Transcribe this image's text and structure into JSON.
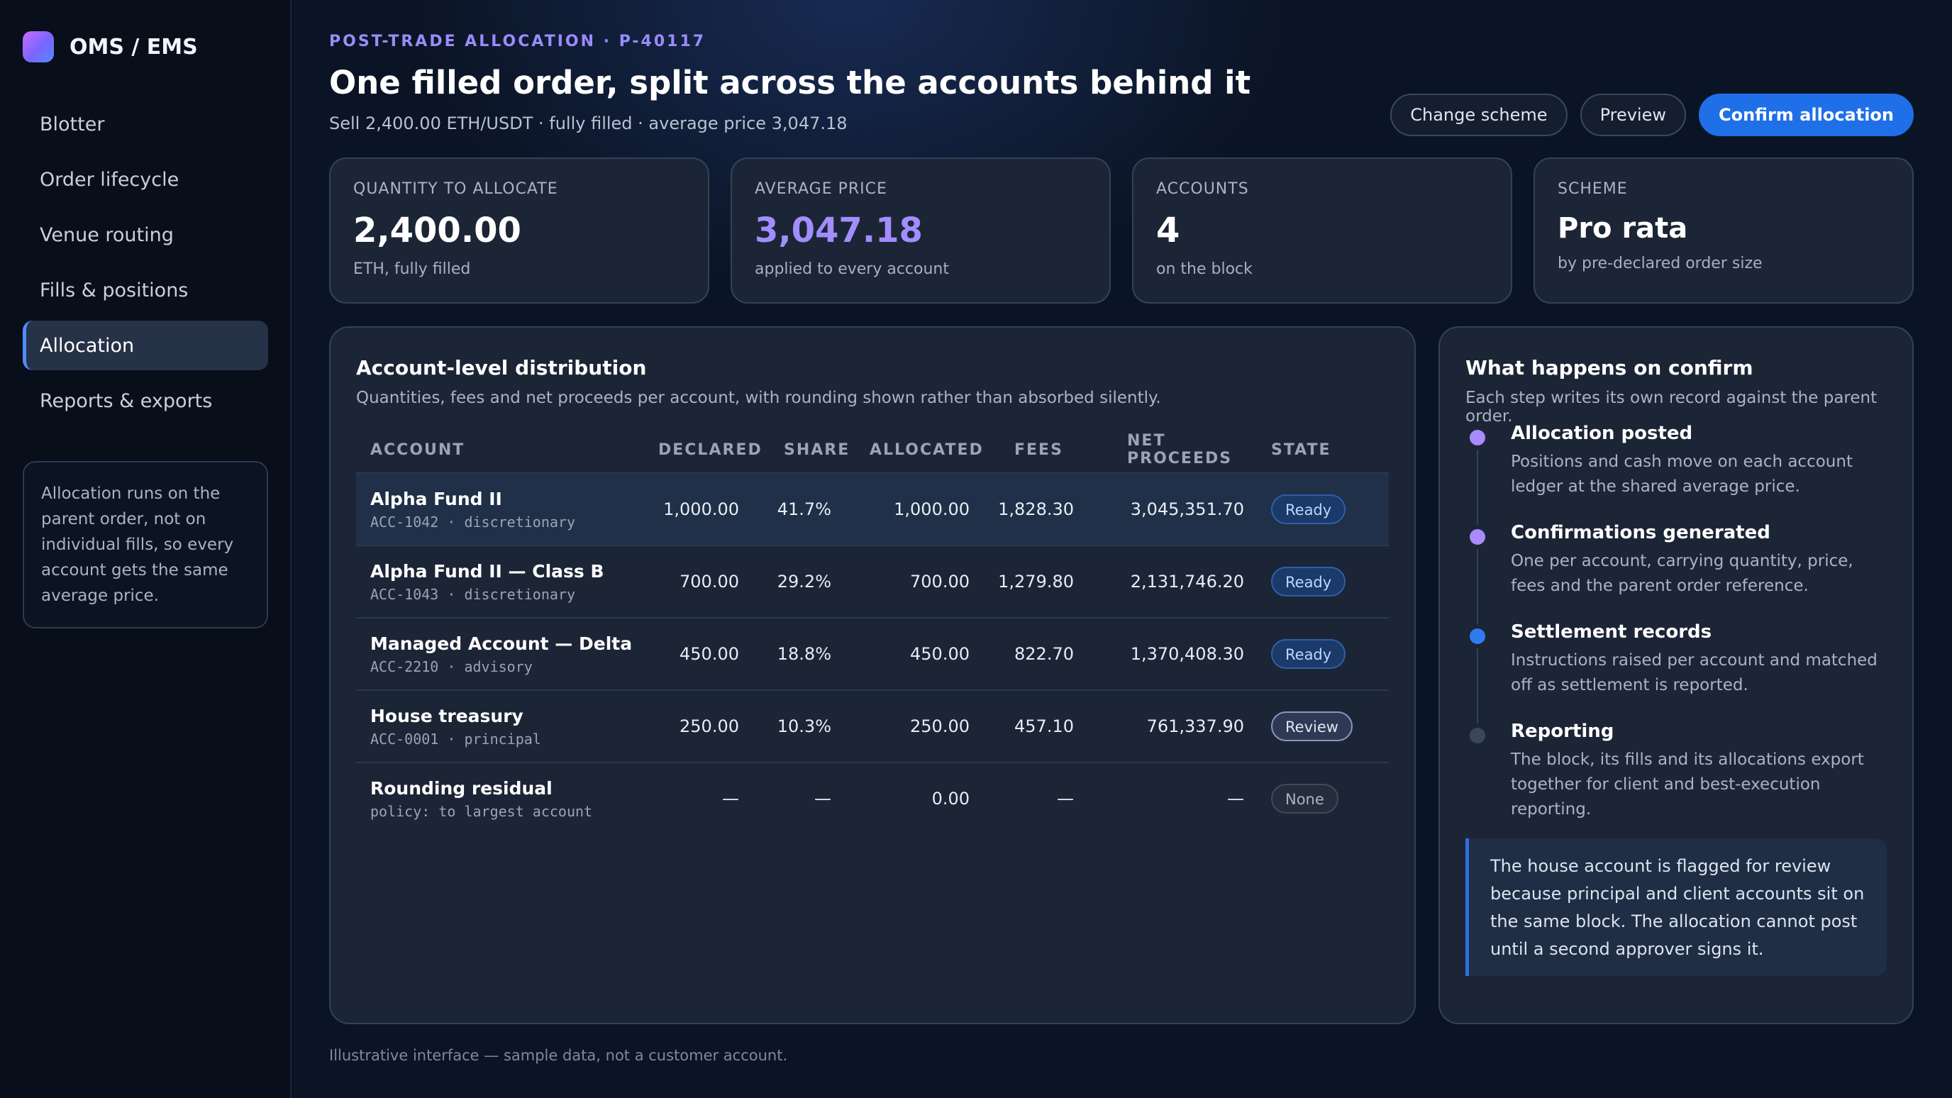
{
  "app": {
    "brand": "OMS / EMS"
  },
  "sidebar": {
    "items": [
      {
        "label": "Blotter"
      },
      {
        "label": "Order lifecycle"
      },
      {
        "label": "Venue routing"
      },
      {
        "label": "Fills & positions"
      },
      {
        "label": "Allocation",
        "active": true
      },
      {
        "label": "Reports & exports"
      }
    ],
    "note": "Allocation runs on the parent order, not on individual fills, so every account gets the same average price."
  },
  "header": {
    "eyebrow": "POST-TRADE ALLOCATION · P-40117",
    "title": "One filled order, split across the accounts behind it",
    "subtitle": "Sell 2,400.00 ETH/USDT · fully filled · average price 3,047.18",
    "buttons": {
      "change_scheme": "Change scheme",
      "preview": "Preview",
      "confirm": "Confirm allocation"
    }
  },
  "stats": [
    {
      "label": "QUANTITY TO ALLOCATE",
      "value": "2,400.00",
      "note": "ETH, fully filled"
    },
    {
      "label": "AVERAGE PRICE",
      "value": "3,047.18",
      "note": "applied to every account"
    },
    {
      "label": "ACCOUNTS",
      "value": "4",
      "note": "on the block"
    },
    {
      "label": "SCHEME",
      "value": "Pro rata",
      "note": "by pre-declared order size"
    }
  ],
  "distribution": {
    "title": "Account-level distribution",
    "subtitle": "Quantities, fees and net proceeds per account, with rounding shown rather than absorbed silently.",
    "columns": [
      "ACCOUNT",
      "DECLARED",
      "SHARE",
      "ALLOCATED",
      "FEES",
      "NET PROCEEDS",
      "STATE"
    ],
    "rows": [
      {
        "name": "Alpha Fund II",
        "meta": "ACC-1042 · discretionary",
        "declared": "1,000.00",
        "share": "41.7%",
        "allocated": "1,000.00",
        "fees": "1,828.30",
        "net": "3,045,351.70",
        "state": "Ready"
      },
      {
        "name": "Alpha Fund II — Class B",
        "meta": "ACC-1043 · discretionary",
        "declared": "700.00",
        "share": "29.2%",
        "allocated": "700.00",
        "fees": "1,279.80",
        "net": "2,131,746.20",
        "state": "Ready"
      },
      {
        "name": "Managed Account — Delta",
        "meta": "ACC-2210 · advisory",
        "declared": "450.00",
        "share": "18.8%",
        "allocated": "450.00",
        "fees": "822.70",
        "net": "1,370,408.30",
        "state": "Ready"
      },
      {
        "name": "House treasury",
        "meta": "ACC-0001 · principal",
        "declared": "250.00",
        "share": "10.3%",
        "allocated": "250.00",
        "fees": "457.10",
        "net": "761,337.90",
        "state": "Review"
      },
      {
        "name": "Rounding residual",
        "meta": "policy: to largest account",
        "declared": "—",
        "share": "—",
        "allocated": "0.00",
        "fees": "—",
        "net": "—",
        "state": "None"
      }
    ]
  },
  "confirm": {
    "title": "What happens on confirm",
    "subtitle": "Each step writes its own record against the parent order.",
    "steps": [
      {
        "title": "Allocation posted",
        "desc": "Positions and cash move on each account ledger at the shared average price.",
        "dot_color": "#a98bff"
      },
      {
        "title": "Confirmations generated",
        "desc": "One per account, carrying quantity, price, fees and the parent order reference.",
        "dot_color": "#a98bff"
      },
      {
        "title": "Settlement records",
        "desc": "Instructions raised per account and matched off as settlement is reported.",
        "dot_color": "#2f7cf0"
      },
      {
        "title": "Reporting",
        "desc": "The block, its fills and its allocations export together for client and best-execution reporting.",
        "dot_color": "#3b4658"
      }
    ],
    "callout": "The house account is flagged for review because principal and client accounts sit on the same block. The allocation cannot post until a second approver signs it."
  },
  "footnote": "Illustrative interface — sample data, not a customer account."
}
